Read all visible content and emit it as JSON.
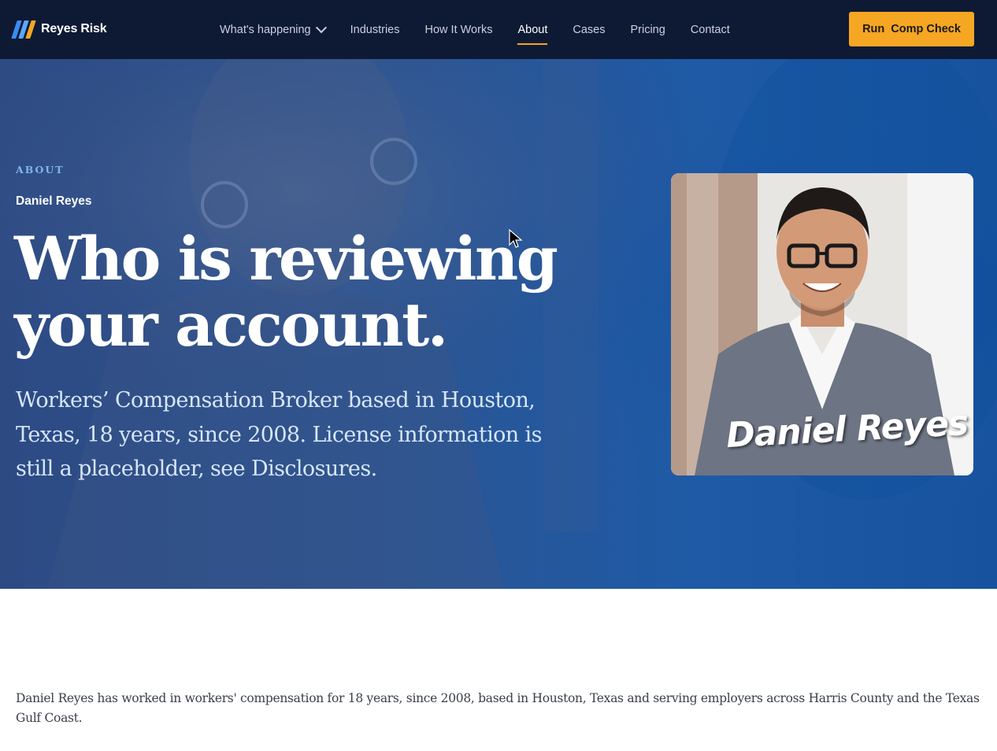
{
  "brand": {
    "name": "Reyes Risk",
    "mark_colors": [
      "#3b8cf0",
      "#5aa8ff",
      "#f5a623"
    ]
  },
  "nav": {
    "items": [
      {
        "label": "What's happening",
        "dropdown": true,
        "active": false
      },
      {
        "label": "Industries",
        "active": false
      },
      {
        "label": "How It Works",
        "active": false
      },
      {
        "label": "About",
        "active": true
      },
      {
        "label": "Cases",
        "active": false
      },
      {
        "label": "Pricing",
        "active": false
      },
      {
        "label": "Contact",
        "active": false
      }
    ],
    "cta_label": "Run  Comp Check"
  },
  "hero": {
    "eyebrow": "ABOUT",
    "byline": "Daniel Reyes",
    "headline": "Who is reviewing your account.",
    "subhead": "Workers’ Compensation Broker based in Houston, Texas, 18 years, since 2008. License information is still a placeholder, see Disclosures.",
    "portrait_signature": "Daniel Reyes"
  },
  "intro": {
    "text": "Daniel Reyes has worked in workers' compensation for 18 years, since 2008, based in Houston, Texas and serving employers across Harris County and the Texas Gulf Coast."
  },
  "colors": {
    "nav_bg": "#0e1a33",
    "accent": "#f5a623",
    "hero_blue": "#1e5aa6"
  }
}
